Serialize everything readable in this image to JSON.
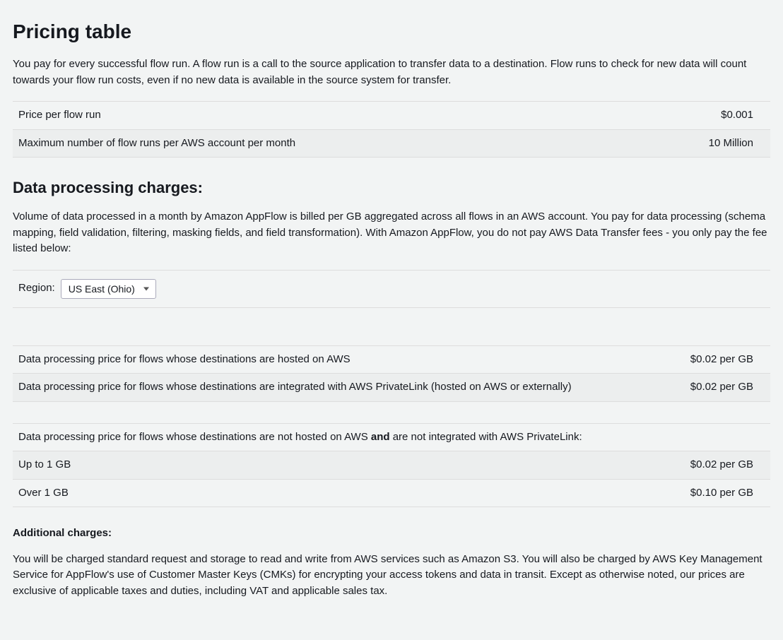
{
  "title": "Pricing table",
  "intro": "You pay for every successful flow run. A flow run is a call to the source application to transfer data to a destination. Flow runs to check for new data will count towards your flow run costs, even if no new data is available in the source system for transfer.",
  "flowrun_table": {
    "rows": [
      {
        "label": "Price per flow run",
        "value": "$0.001"
      },
      {
        "label": "Maximum number of flow runs per AWS account per month",
        "value": "10 Million"
      }
    ]
  },
  "section2_title": "Data processing charges:",
  "section2_intro": "Volume of data processed in a month by Amazon AppFlow is billed per GB aggregated across all flows in an AWS account. You pay for data processing (schema mapping, field validation, filtering, masking fields, and field transformation). With Amazon AppFlow, you do not pay AWS Data Transfer fees - you only pay the fee listed below:",
  "region": {
    "label": "Region:",
    "selected": "US East (Ohio)"
  },
  "dp_table1": {
    "rows": [
      {
        "label": "Data processing price for flows whose destinations are hosted on AWS",
        "value": "$0.02 per GB"
      },
      {
        "label": "Data processing price for flows whose destinations are integrated with AWS PrivateLink (hosted on AWS or externally)",
        "value": "$0.02 per GB"
      }
    ]
  },
  "dp_header": {
    "prefix": "Data processing price for flows whose destinations are not hosted on AWS ",
    "bold": "and",
    "suffix": " are not integrated with AWS PrivateLink:"
  },
  "dp_table2": {
    "rows": [
      {
        "label": "Up to 1 GB",
        "value": "$0.02 per GB"
      },
      {
        "label": "Over 1 GB",
        "value": "$0.10 per GB"
      }
    ]
  },
  "additional_title": "Additional charges:",
  "additional_body": "You will be charged standard request and storage to read and write from AWS services such as Amazon S3. You will also be charged by AWS Key Management Service for AppFlow's use of Customer Master Keys (CMKs) for encrypting your access tokens and data in transit. Except as otherwise noted, our prices are exclusive of applicable taxes and duties, including VAT and applicable sales tax."
}
